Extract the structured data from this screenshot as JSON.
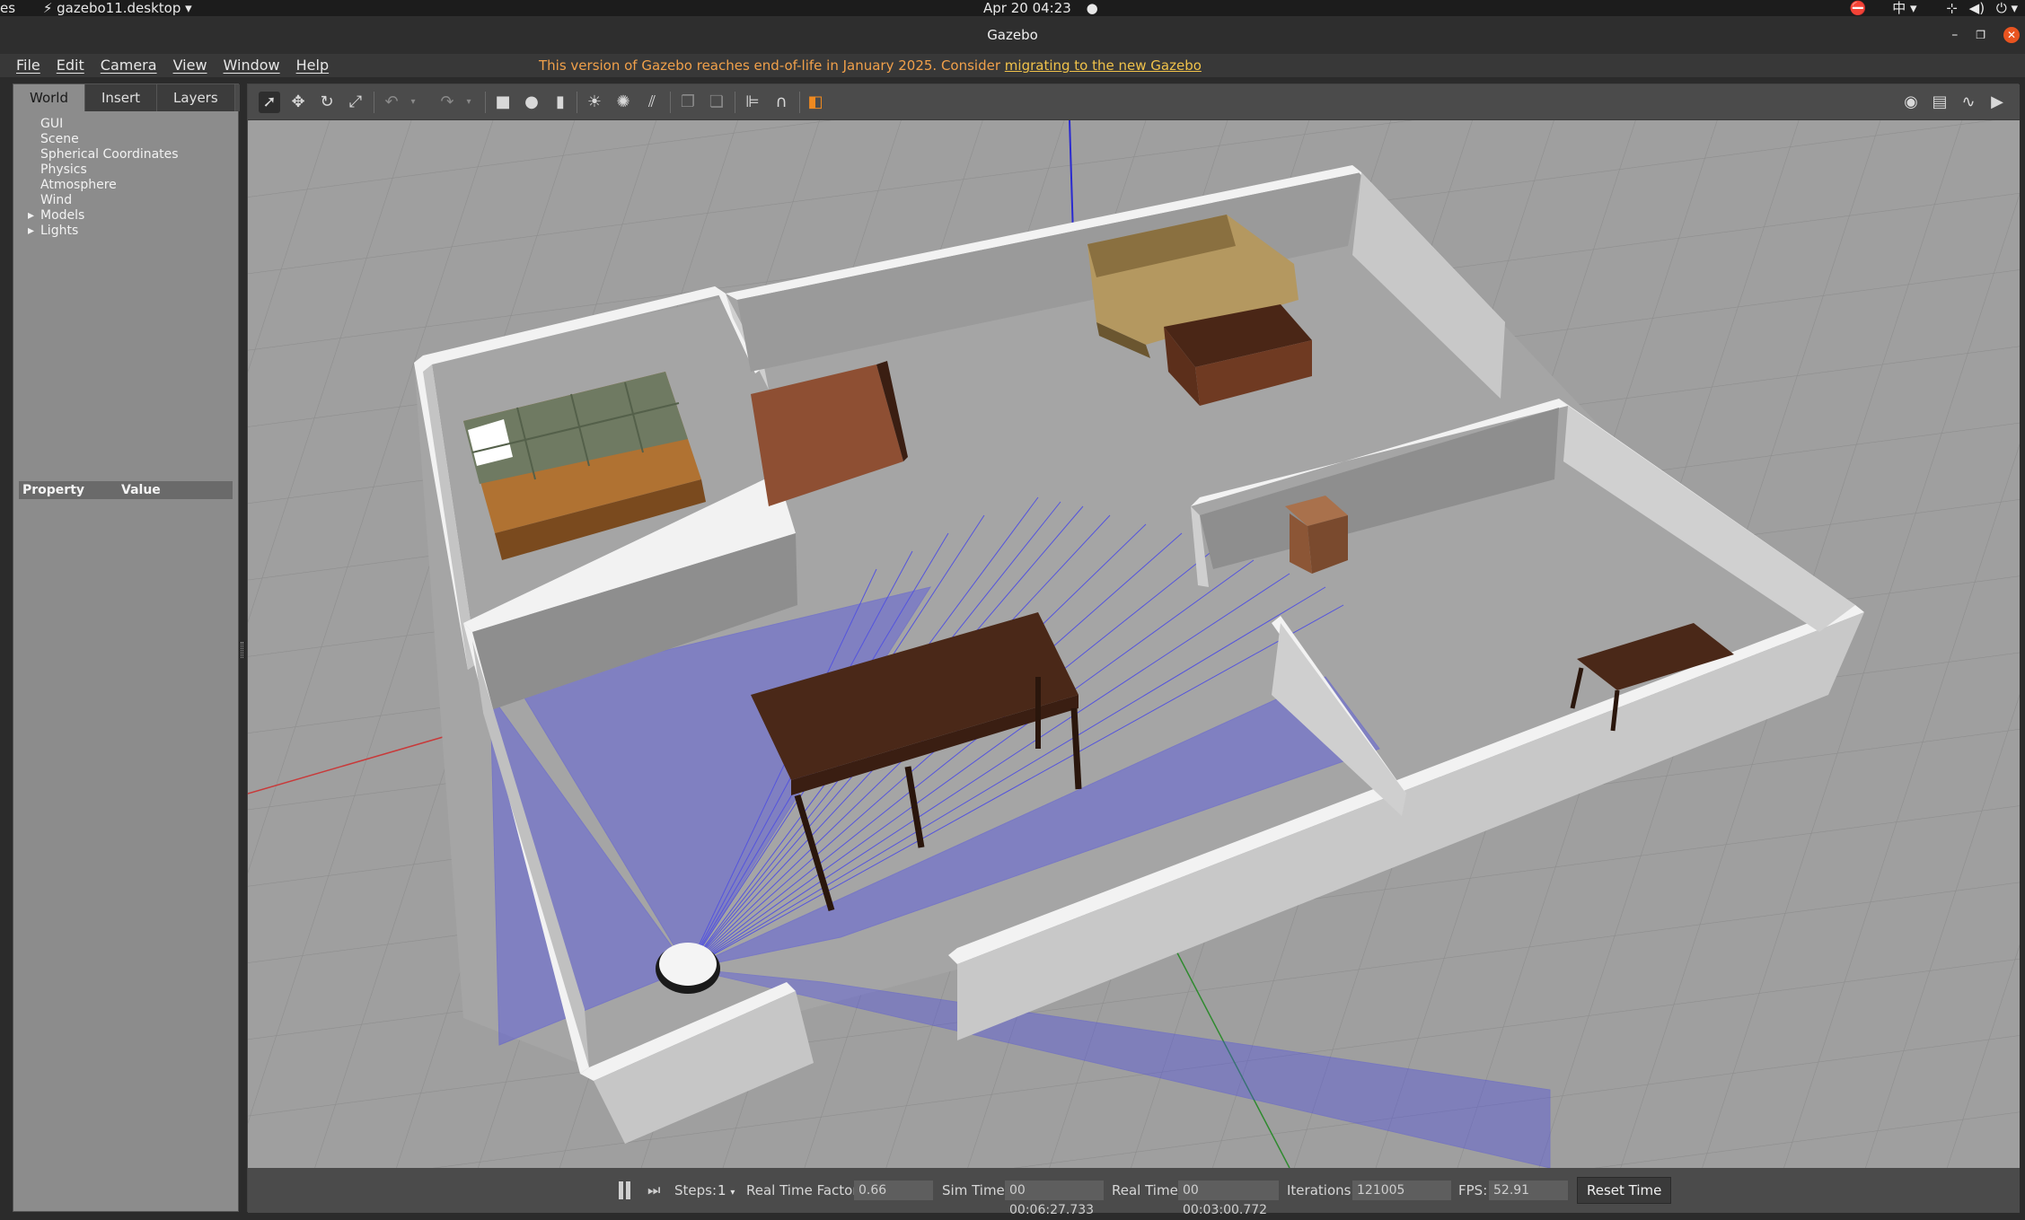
{
  "ubuntu_bar": {
    "left_text": "es",
    "app_menu": "gazebo11.desktop",
    "clock": "Apr 20  04:23",
    "ime": "中"
  },
  "window": {
    "title": "Gazebo"
  },
  "menu": {
    "items": [
      "File",
      "Edit",
      "Camera",
      "View",
      "Window",
      "Help"
    ],
    "notice_text": "This version of Gazebo reaches end-of-life in January 2025. Consider ",
    "notice_link": "migrating to the new Gazebo"
  },
  "left_panel": {
    "tabs": [
      "World",
      "Insert",
      "Layers"
    ],
    "tree": [
      "GUI",
      "Scene",
      "Spherical Coordinates",
      "Physics",
      "Atmosphere",
      "Wind"
    ],
    "tree_expandable": [
      "Models",
      "Lights"
    ],
    "property_header": "Property",
    "value_header": "Value"
  },
  "bottom_bar": {
    "steps_label": "Steps:",
    "steps_value": "1",
    "rtf_label": "Real Time Factor:",
    "rtf_value": "0.66",
    "sim_time_label": "Sim Time:",
    "sim_time_value": "00 00:06:27.733",
    "real_time_label": "Real Time:",
    "real_time_value": "00 00:03:00.772",
    "iterations_label": "Iterations:",
    "iterations_value": "121005",
    "fps_label": "FPS:",
    "fps_value": "52.91",
    "reset_label": "Reset Time"
  },
  "colors": {
    "laser": "#3a3af0",
    "wall_top": "#f2f2f2",
    "wall_side": "#c8c8c8",
    "floor": "#9f9f9f",
    "notice": "#f0a04a"
  }
}
